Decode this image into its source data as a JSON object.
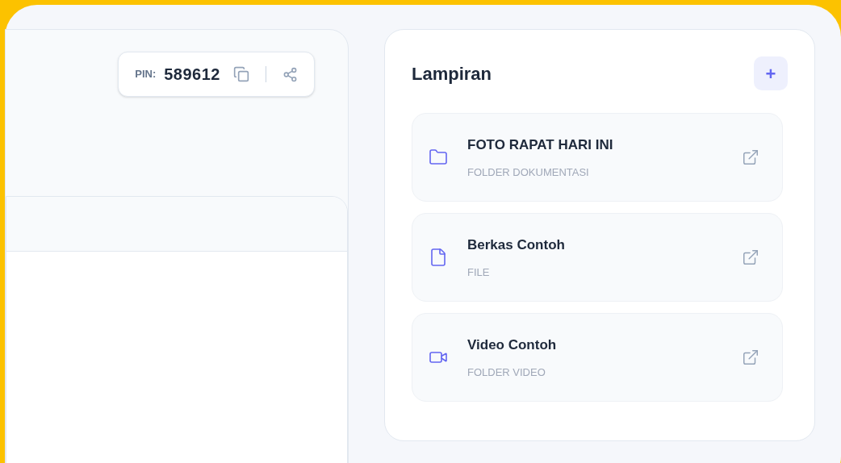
{
  "pin": {
    "label": "PIN:",
    "value": "589612"
  },
  "attachments": {
    "title": "Lampiran",
    "add_button": "+",
    "items": [
      {
        "kind": "folder",
        "title": "FOTO RAPAT HARI INI",
        "subtitle": "FOLDER DOKUMENTASI"
      },
      {
        "kind": "file",
        "title": "Berkas Contoh",
        "subtitle": "FILE"
      },
      {
        "kind": "video",
        "title": "Video Contoh",
        "subtitle": "FOLDER VIDEO"
      }
    ]
  }
}
